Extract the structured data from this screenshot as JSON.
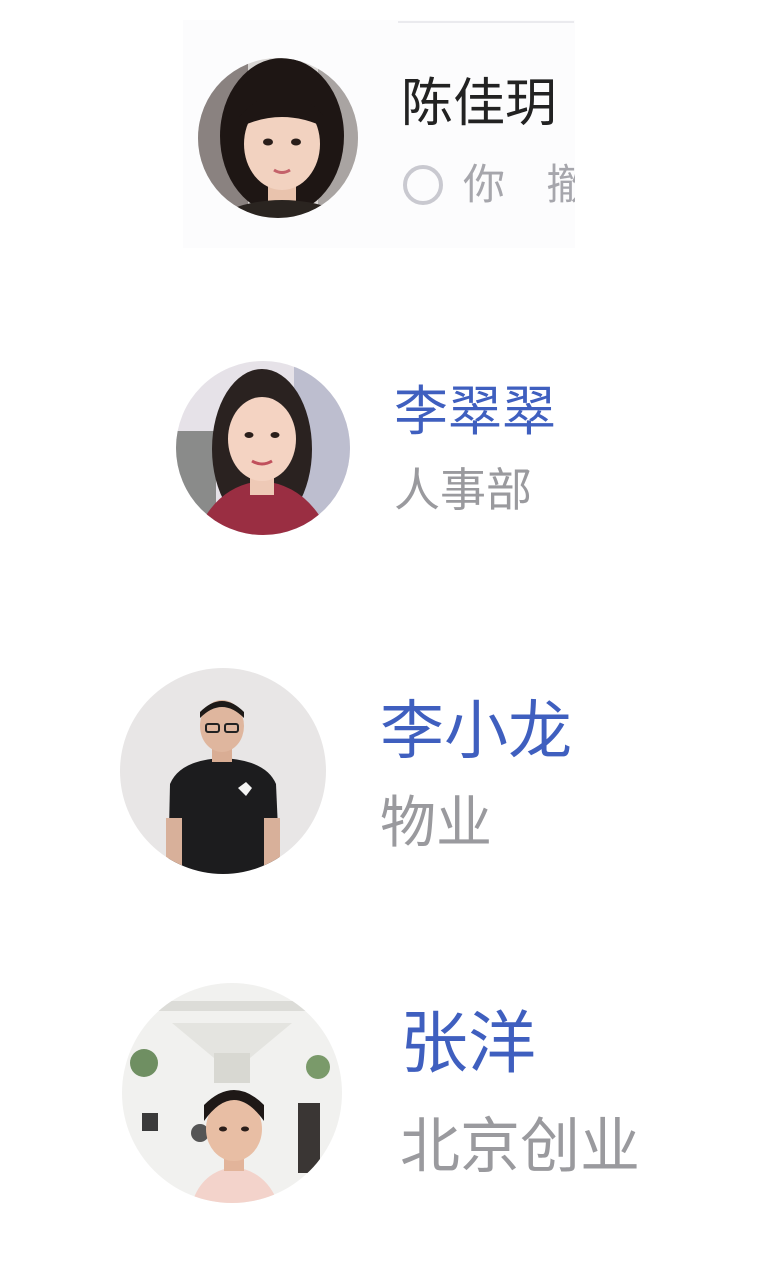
{
  "contacts": [
    {
      "name": "陈佳玥",
      "status_text": "你 撤",
      "status_icon": "radio-circle-icon",
      "name_color": "#222222",
      "avatar": "avatar-photo-woman-bangs"
    },
    {
      "name": "李翠翠",
      "dept": "人事部",
      "name_color": "#3f5fbf",
      "avatar": "avatar-photo-woman-red-top"
    },
    {
      "name": "李小龙",
      "dept": "物业",
      "name_color": "#3f5fbf",
      "avatar": "avatar-photo-man-black-shirt"
    },
    {
      "name": "张洋",
      "dept": "北京创业",
      "name_color": "#3f5fbf",
      "avatar": "avatar-photo-woman-living-room"
    }
  ]
}
